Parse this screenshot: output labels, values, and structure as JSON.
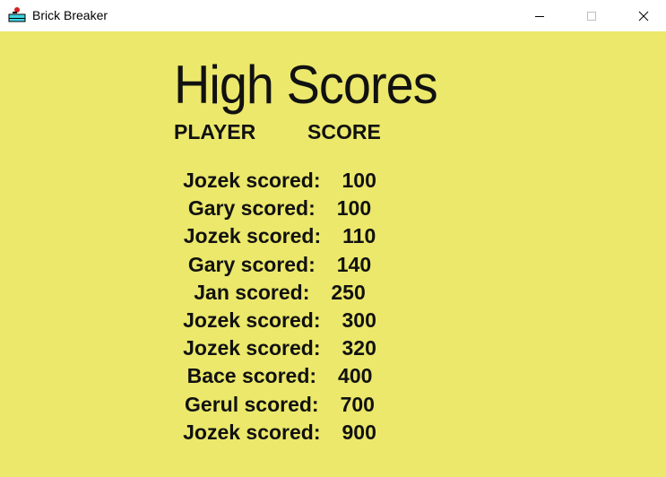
{
  "window": {
    "title": "Brick Breaker",
    "icon": "brick-breaker-app-icon",
    "controls": {
      "minimize_icon": "minimize-icon",
      "maximize_icon": "maximize-icon",
      "close_icon": "close-icon"
    }
  },
  "colors": {
    "background": "#ebe86b",
    "text": "#111111",
    "titlebar": "#ffffff"
  },
  "screen": {
    "heading": "High Scores",
    "columns": {
      "player": "PLAYER",
      "score": "SCORE"
    },
    "entries": [
      {
        "label": "Jozek scored:",
        "score": "100"
      },
      {
        "label": "Gary scored:",
        "score": "100"
      },
      {
        "label": "Jozek scored:",
        "score": "110"
      },
      {
        "label": "Gary scored:",
        "score": "140"
      },
      {
        "label": "Jan scored:",
        "score": "250"
      },
      {
        "label": "Jozek scored:",
        "score": "300"
      },
      {
        "label": "Jozek scored:",
        "score": "320"
      },
      {
        "label": "Bace scored:",
        "score": "400"
      },
      {
        "label": "Gerul scored:",
        "score": "700"
      },
      {
        "label": "Jozek scored:",
        "score": "900"
      }
    ]
  }
}
